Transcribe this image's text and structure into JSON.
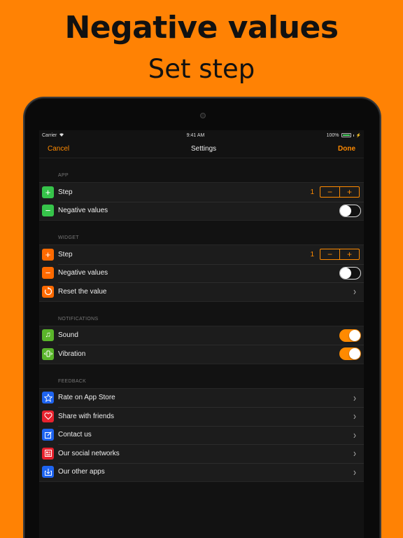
{
  "headline": {
    "title": "Negative values",
    "subtitle": "Set step"
  },
  "status": {
    "carrier": "Carrier",
    "time": "9:41 AM",
    "battery": "100%"
  },
  "nav": {
    "cancel": "Cancel",
    "title": "Settings",
    "done": "Done"
  },
  "sections": {
    "app": {
      "header": "APP",
      "step_label": "Step",
      "step_value": "1",
      "neg_label": "Negative values"
    },
    "widget": {
      "header": "WIDGET",
      "step_label": "Step",
      "step_value": "1",
      "neg_label": "Negative values",
      "reset_label": "Reset the value"
    },
    "notifications": {
      "header": "NOTIFICATIONS",
      "sound_label": "Sound",
      "vibration_label": "Vibration"
    },
    "feedback": {
      "header": "FEEDBACK",
      "rate_label": "Rate on App Store",
      "share_label": "Share with friends",
      "contact_label": "Contact us",
      "social_label": "Our social networks",
      "apps_label": "Our other apps"
    }
  },
  "stepper": {
    "minus": "−",
    "plus": "+"
  },
  "toggles": {
    "app_negative": false,
    "widget_negative": false,
    "sound": true,
    "vibration": true
  },
  "icons": {
    "plus": "plus-icon",
    "minus": "minus-icon",
    "reset": "reset-icon",
    "sound": "music-note-icon",
    "vibration": "vibration-icon",
    "rate": "star-icon",
    "share": "heart-icon",
    "contact": "compose-icon",
    "social": "social-icon",
    "apps": "download-icon"
  },
  "colors": {
    "background": "#FF8204",
    "accent": "#FF8A00",
    "app_icon": "#36C44A",
    "widget_icon": "#FF6A00",
    "notif_icon": "#5AB52A",
    "blue_icon": "#1E64F0",
    "red_icon": "#E8222E"
  }
}
